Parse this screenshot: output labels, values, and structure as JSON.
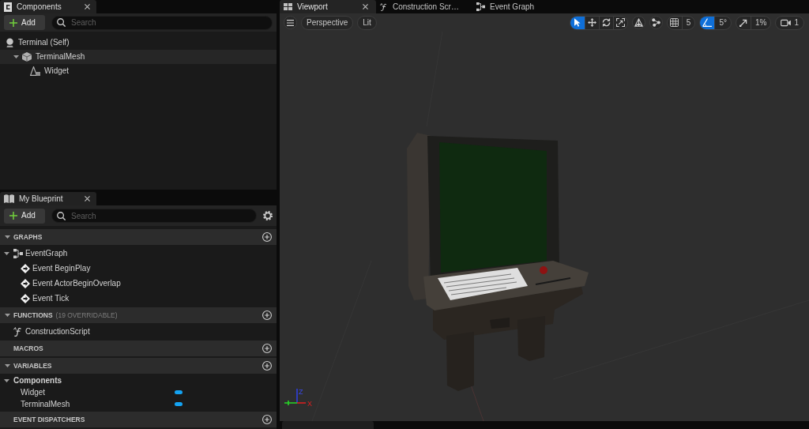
{
  "components_panel": {
    "tab": {
      "title": "Components"
    },
    "add_button": "Add",
    "search": {
      "placeholder": "Search"
    },
    "tree": [
      {
        "label": "Terminal (Self)",
        "kind": "actor",
        "selected": false,
        "children": [
          {
            "label": "TerminalMesh",
            "kind": "mesh",
            "selected": true,
            "expanded": true,
            "children": [
              {
                "label": "Widget",
                "kind": "widget",
                "selected": false
              }
            ]
          }
        ]
      }
    ]
  },
  "my_blueprint_panel": {
    "tab": {
      "title": "My Blueprint"
    },
    "add_button": "Add",
    "search": {
      "placeholder": "Search"
    },
    "sections": [
      {
        "title": "GRAPHS",
        "expanded": true,
        "items": [
          {
            "label": "EventGraph",
            "kind": "graph",
            "expanded": true,
            "children": [
              {
                "label": "Event BeginPlay",
                "kind": "event"
              },
              {
                "label": "Event ActorBeginOverlap",
                "kind": "event"
              },
              {
                "label": "Event Tick",
                "kind": "event"
              }
            ]
          }
        ]
      },
      {
        "title": "FUNCTIONS",
        "note": "(19 OVERRIDABLE)",
        "expanded": true,
        "items": [
          {
            "label": "ConstructionScript",
            "kind": "function"
          }
        ]
      },
      {
        "title": "MACROS",
        "expanded": false
      },
      {
        "title": "VARIABLES",
        "expanded": true,
        "items": [
          {
            "label": "Components",
            "kind": "category",
            "expanded": true,
            "children": [
              {
                "label": "Widget",
                "kind": "variable",
                "color": "#14a3f2"
              },
              {
                "label": "TerminalMesh",
                "kind": "variable",
                "color": "#14a3f2"
              }
            ]
          }
        ]
      },
      {
        "title": "EVENT DISPATCHERS",
        "expanded": false
      }
    ]
  },
  "viewport_tabs": [
    {
      "label": "Viewport",
      "kind": "viewport",
      "selected": true
    },
    {
      "label": "Construction Scr…",
      "kind": "function",
      "selected": false
    },
    {
      "label": "Event Graph",
      "kind": "graph",
      "selected": false
    }
  ],
  "viewport_toolbar": {
    "view_mode": "Perspective",
    "lighting": "Lit",
    "transform_tools": [
      {
        "kind": "select",
        "selected": true
      },
      {
        "kind": "move",
        "selected": false
      },
      {
        "kind": "rotate",
        "selected": false
      },
      {
        "kind": "scale",
        "selected": false
      }
    ],
    "snaps": [
      {
        "kind": "grid",
        "value": "5",
        "on": false
      },
      {
        "kind": "rotation",
        "value": "5°",
        "on": true
      },
      {
        "kind": "scale",
        "value": "1%",
        "on": false
      }
    ],
    "camera_speed": "1"
  },
  "viewport": {
    "axis_gizmo": {
      "z_label": "Z",
      "x_label": "X"
    }
  }
}
